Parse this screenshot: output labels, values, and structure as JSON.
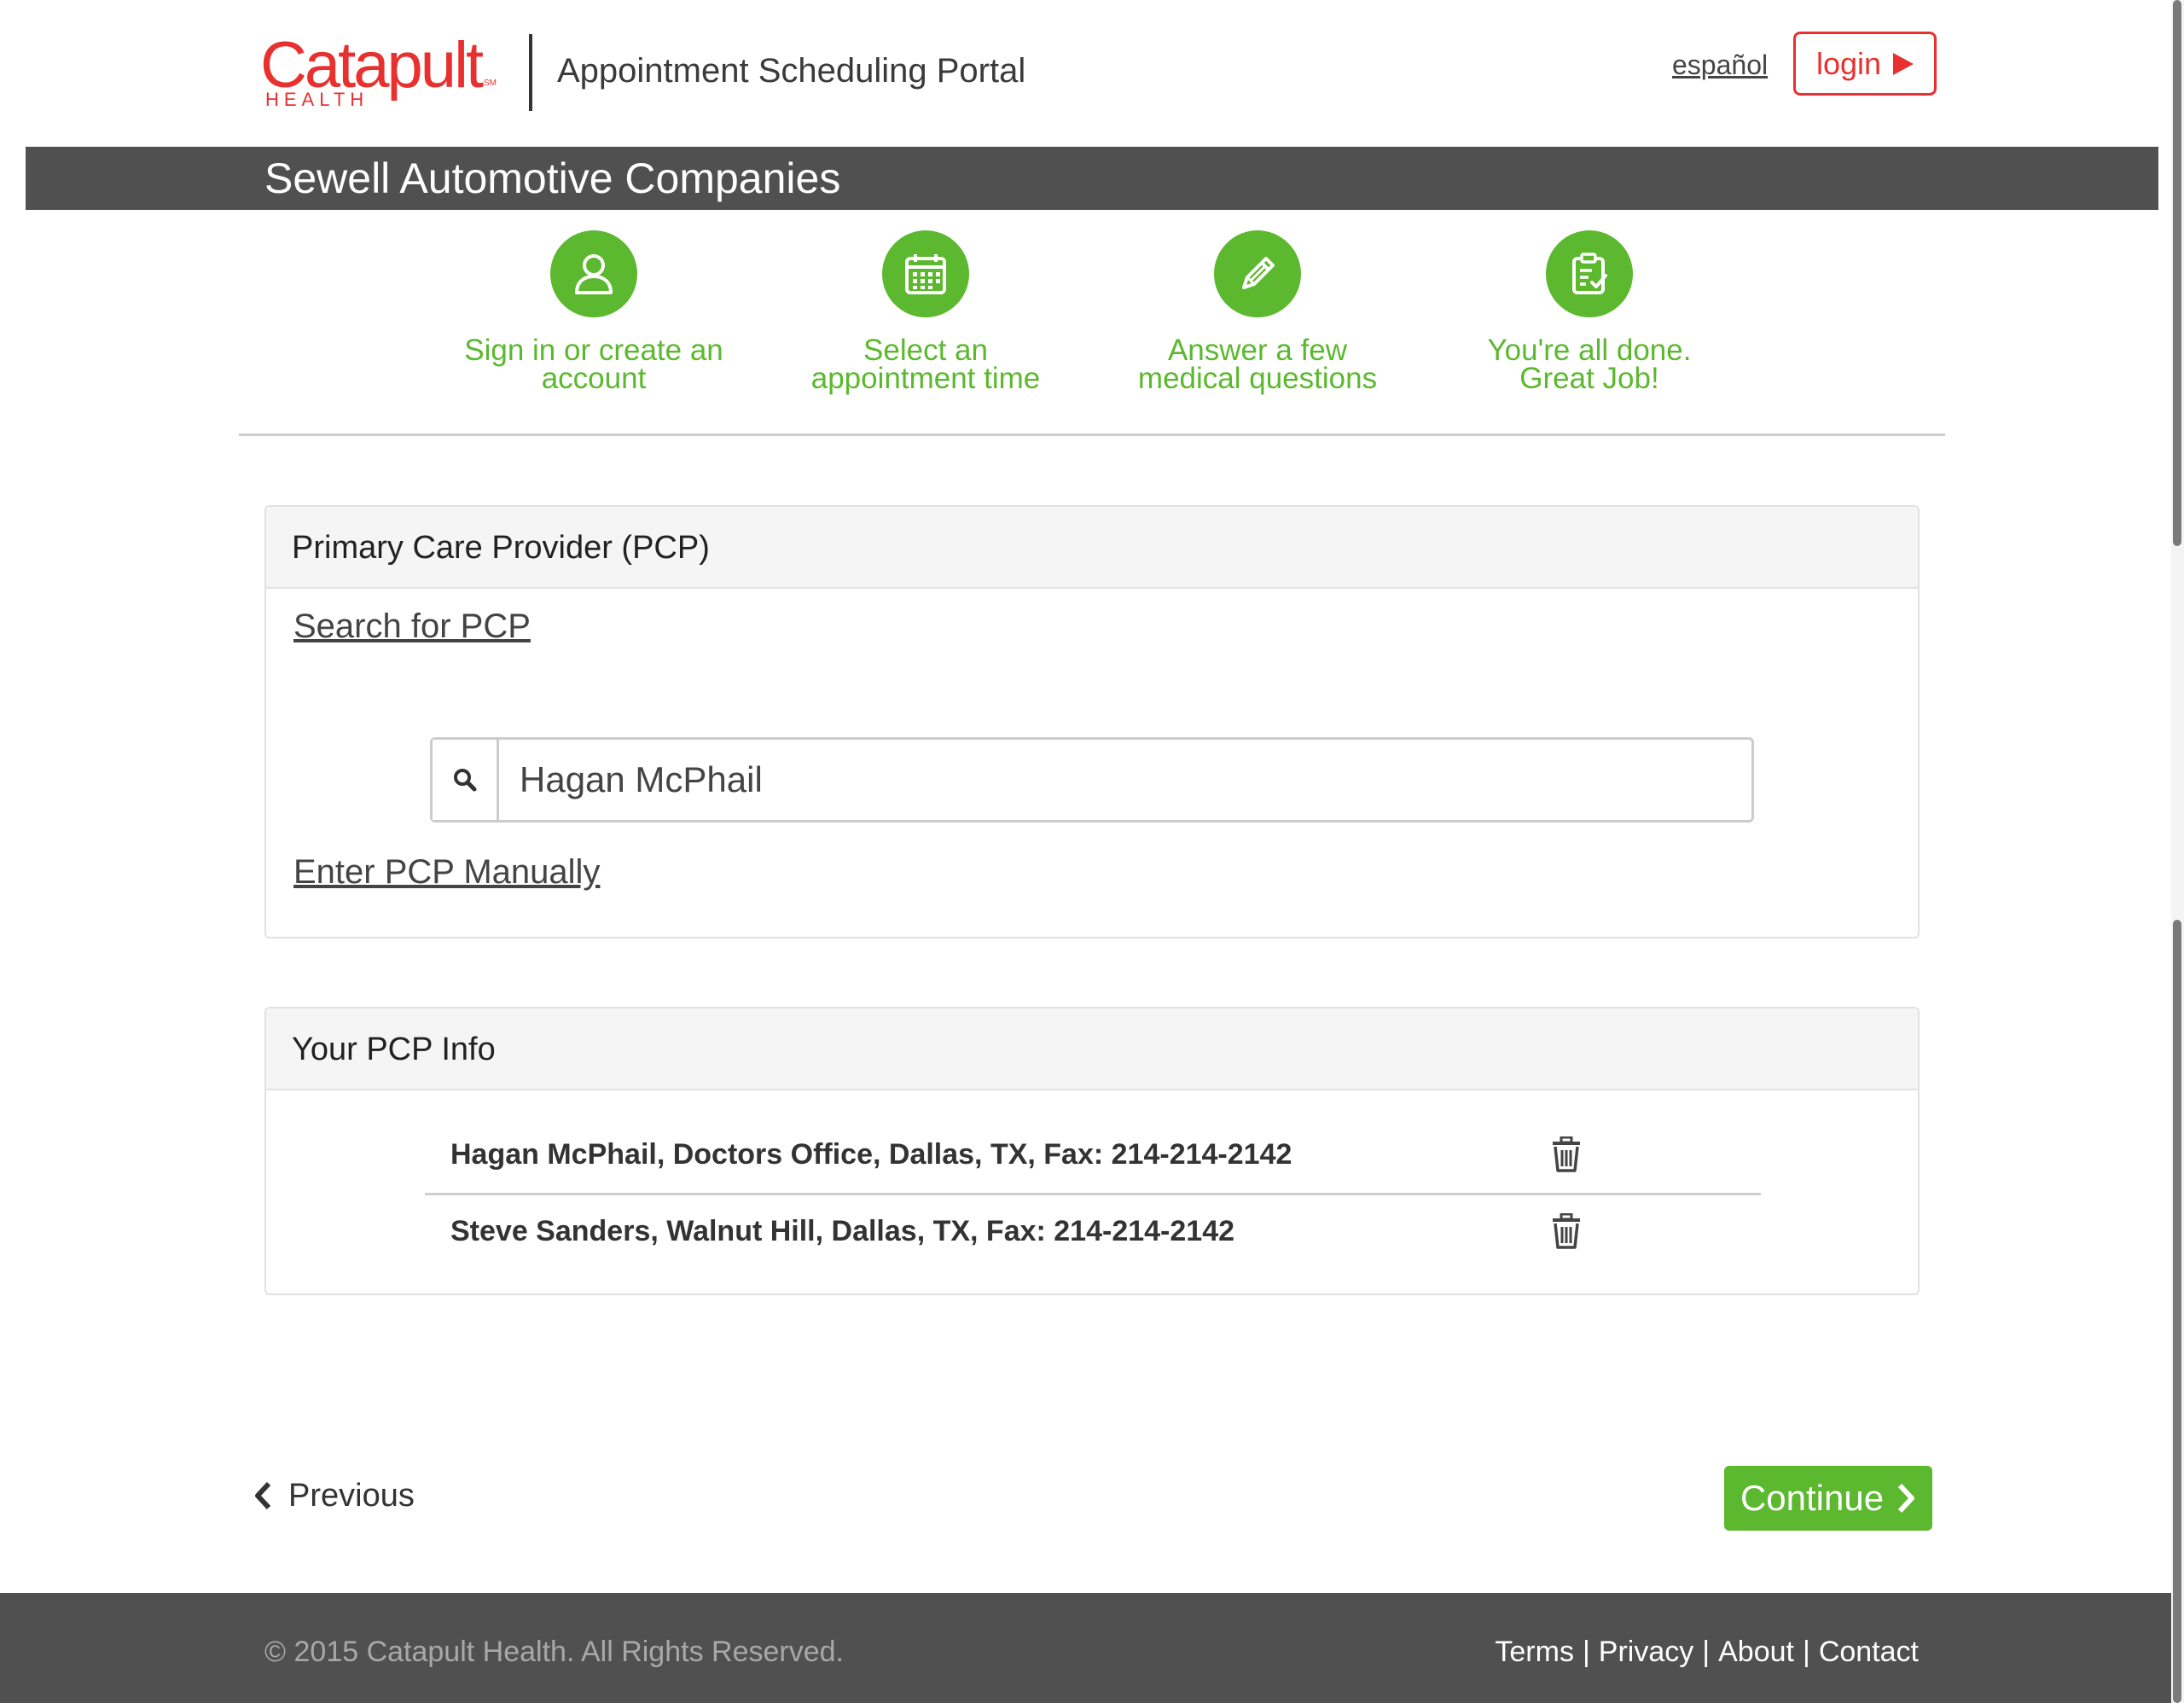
{
  "brand": {
    "logo_text": "Catapult",
    "logo_sub": "HEALTH",
    "logo_mark": "SM",
    "portal_title": "Appointment Scheduling Portal",
    "accent_red": "#e8312f",
    "accent_green": "#5cb82e"
  },
  "header": {
    "language_link": "español",
    "login_label": "login"
  },
  "company": {
    "name": "Sewell Automotive Companies"
  },
  "steps": [
    {
      "icon": "user-icon",
      "line1": "Sign in or create an",
      "line2": "account"
    },
    {
      "icon": "calendar-icon",
      "line1": "Select an",
      "line2": "appointment time"
    },
    {
      "icon": "pencil-icon",
      "line1": "Answer a few",
      "line2": "medical questions"
    },
    {
      "icon": "clipboard-check-icon",
      "line1": "You're all done.",
      "line2": "Great Job!"
    }
  ],
  "pcp_panel": {
    "title": "Primary Care Provider (PCP)",
    "search_link": "Search for PCP",
    "search_value": "Hagan McPhail",
    "manual_link": "Enter PCP Manually"
  },
  "info_panel": {
    "title": "Your PCP Info",
    "rows": [
      {
        "text": "Hagan McPhail, Doctors Office, Dallas, TX, Fax: 214-214-2142",
        "action_icon": "trash-icon"
      },
      {
        "text": "Steve Sanders, Walnut Hill, Dallas, TX, Fax: 214-214-2142",
        "action_icon": "trash-icon"
      }
    ]
  },
  "nav": {
    "previous_label": "Previous",
    "continue_label": "Continue"
  },
  "footer": {
    "copyright": "© 2015 Catapult Health. All Rights Reserved.",
    "links": [
      "Terms",
      "Privacy",
      "About",
      "Contact"
    ]
  }
}
